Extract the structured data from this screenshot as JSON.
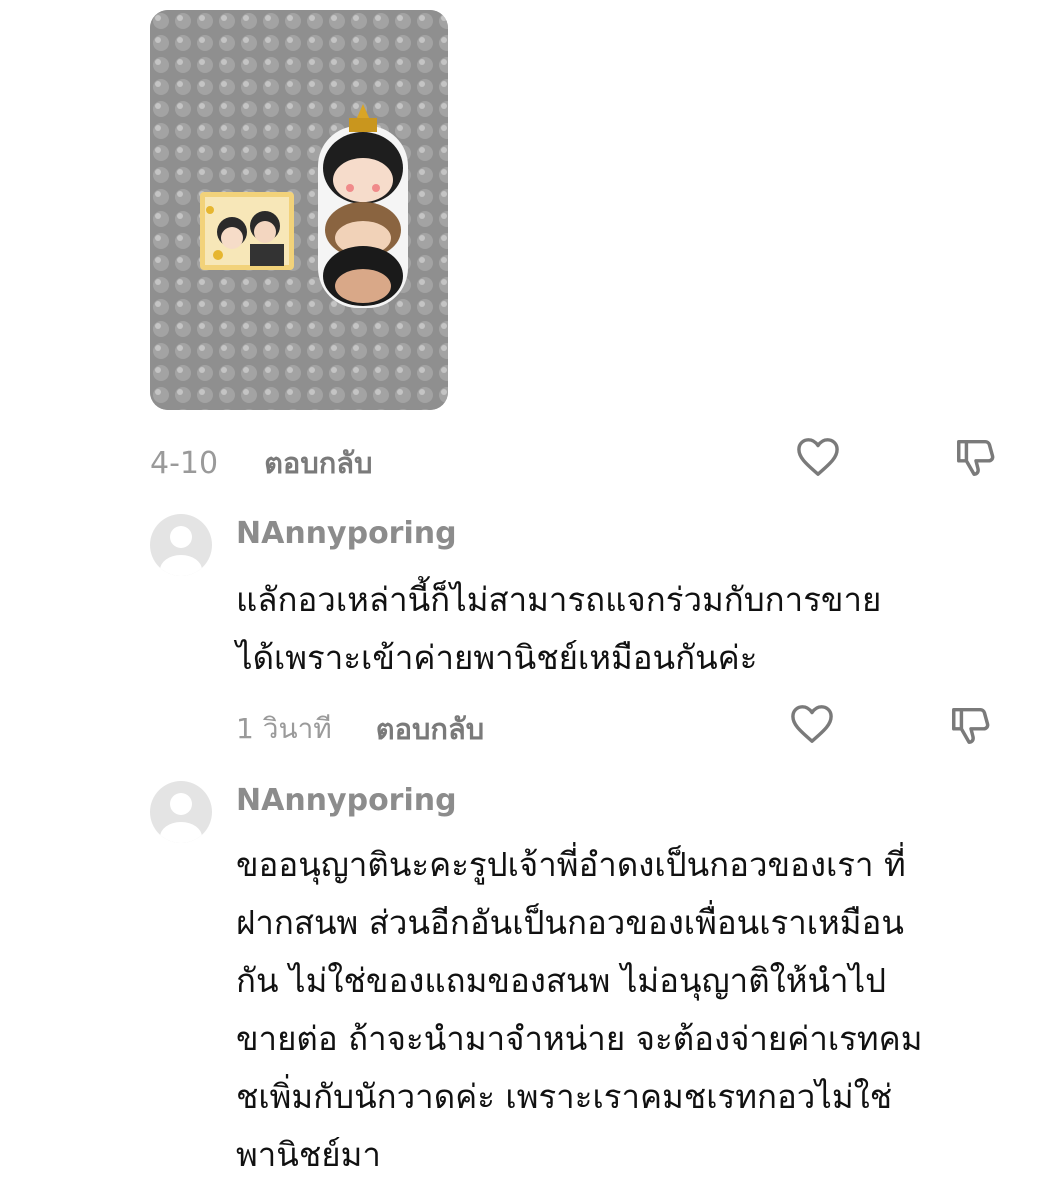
{
  "photo": {
    "alt": "photo of acrylic goods on bubble wrap"
  },
  "first_comment_meta": {
    "date": "4-10",
    "reply_label": "ตอบกลับ"
  },
  "replies": [
    {
      "username": "NAnnyporing",
      "text": "แลักอวเหล่านี้ก็ไม่สามารถแจกร่วมกับการขาย\nได้เพราะเข้าค่ายพานิชย์เหมือนกันค่ะ",
      "time": "1 วินาที",
      "reply_label": "ตอบกลับ"
    },
    {
      "username": "NAnnyporing",
      "text": "ขออนุญาตินะคะรูปเจ้าพี่อำดงเป็นกอวของเรา ที่\nฝากสนพ ส่วนอีกอันเป็นกอวของเพื่อนเราเหมือน\nกัน ไม่ใช่ของแถมของสนพ ไม่อนุญาติให้นำไป\nขายต่อ ถ้าจะนำมาจำหน่าย จะต้องจ่ายค่าเรทคม\nชเพิ่มกับนักวาดค่ะ เพราะเราคมชเรทกอวไม่ใช่\nพานิชย์มา"
    }
  ]
}
